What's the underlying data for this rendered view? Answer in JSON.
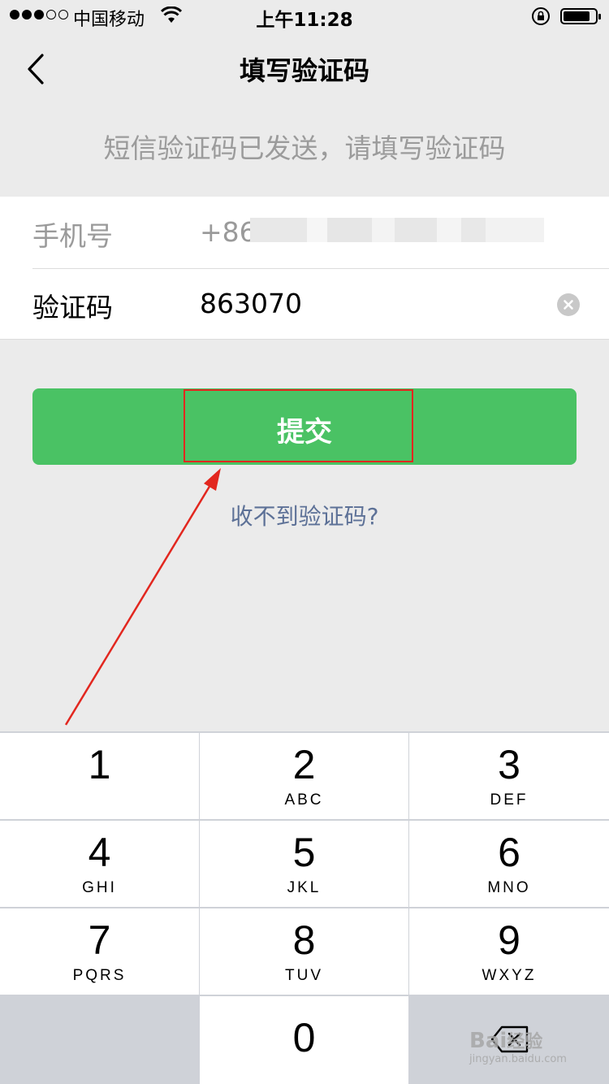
{
  "status_bar": {
    "carrier": "中国移动",
    "time": "上午11:28",
    "signal_filled": 3,
    "signal_total": 5,
    "battery_level": 0.85
  },
  "nav": {
    "title": "填写验证码",
    "back_icon": "chevron-left-icon"
  },
  "hint": "短信验证码已发送，请填写验证码",
  "form": {
    "phone_label": "手机号",
    "phone_value": "+86",
    "code_label": "验证码",
    "code_value": "863070",
    "clear_icon": "clear-icon"
  },
  "submit_label": "提交",
  "no_receive_link": "收不到验证码?",
  "keypad": [
    {
      "num": "1",
      "letters": ""
    },
    {
      "num": "2",
      "letters": "ABC"
    },
    {
      "num": "3",
      "letters": "DEF"
    },
    {
      "num": "4",
      "letters": "GHI"
    },
    {
      "num": "5",
      "letters": "JKL"
    },
    {
      "num": "6",
      "letters": "MNO"
    },
    {
      "num": "7",
      "letters": "PQRS"
    },
    {
      "num": "8",
      "letters": "TUV"
    },
    {
      "num": "9",
      "letters": "WXYZ"
    },
    {
      "num": "0",
      "letters": ""
    }
  ],
  "watermark": {
    "main": "Bai",
    "main2": "经验",
    "sub": "jingyan.baidu.com"
  },
  "colors": {
    "accent": "#4ac264",
    "link": "#5d7197",
    "annotation": "#e2271f"
  }
}
